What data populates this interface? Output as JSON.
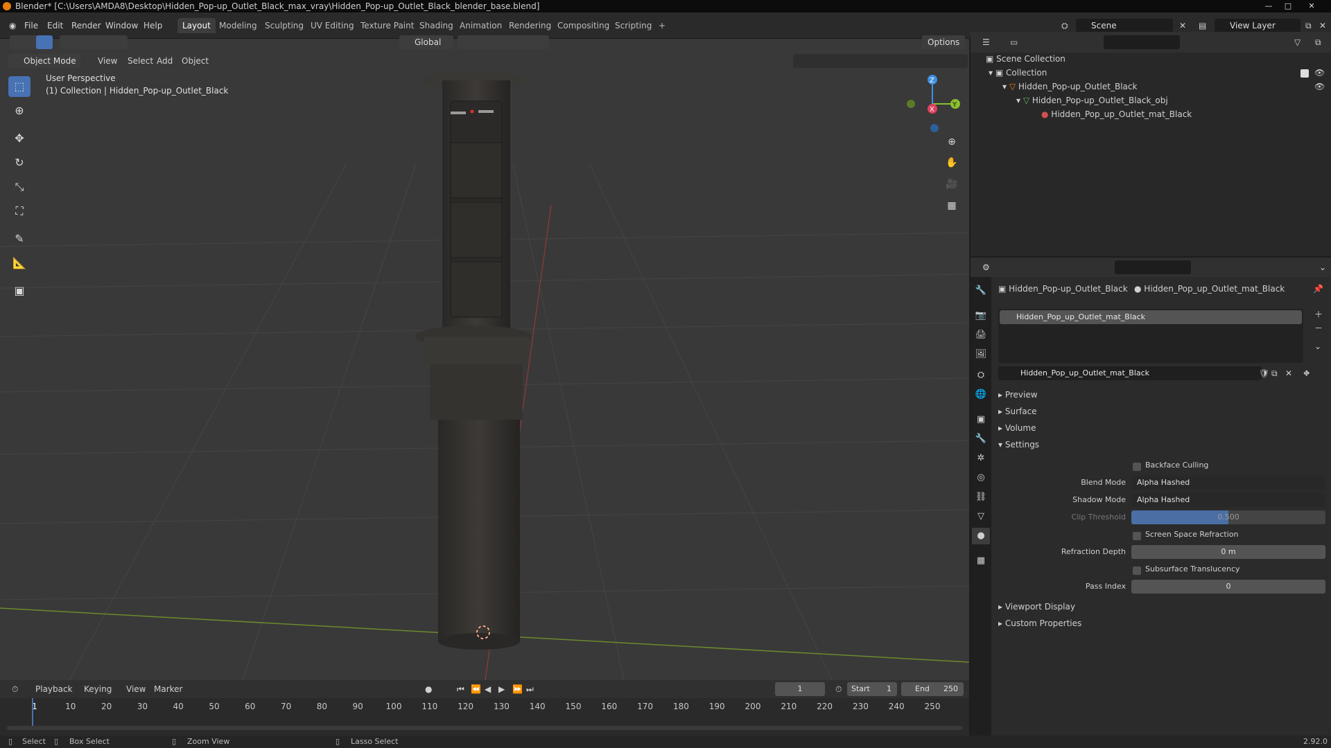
{
  "window": {
    "title": "Blender* [C:\\Users\\AMDA8\\Desktop\\Hidden_Pop-up_Outlet_Black_max_vray\\Hidden_Pop-up_Outlet_Black_blender_base.blend]",
    "minimize": "—",
    "maximize": "□",
    "close": "✕"
  },
  "menu": {
    "file": "File",
    "edit": "Edit",
    "render": "Render",
    "window": "Window",
    "help": "Help"
  },
  "workspaces": [
    "Layout",
    "Modeling",
    "Sculpting",
    "UV Editing",
    "Texture Paint",
    "Shading",
    "Animation",
    "Rendering",
    "Compositing",
    "Scripting"
  ],
  "add_workspace": "+",
  "scene": {
    "label": "Scene",
    "view_layer": "View Layer"
  },
  "toolbar_top": {
    "orientation": "Global",
    "options": "Options"
  },
  "viewport": {
    "mode": "Object Mode",
    "menus": {
      "view": "View",
      "select": "Select",
      "add": "Add",
      "object": "Object"
    },
    "overlay_line1": "User Perspective",
    "overlay_line2": "(1) Collection | Hidden_Pop-up_Outlet_Black",
    "gizmo": {
      "x": "X",
      "y": "Y",
      "z": "Z"
    }
  },
  "outliner": {
    "scene_collection": "Scene Collection",
    "collection": "Collection",
    "object": "Hidden_Pop-up_Outlet_Black",
    "mesh": "Hidden_Pop-up_Outlet_Black_obj",
    "material": "Hidden_Pop_up_Outlet_mat_Black"
  },
  "properties": {
    "breadcrumb_object": "Hidden_Pop-up_Outlet_Black",
    "breadcrumb_material": "Hidden_Pop_up_Outlet_mat_Black",
    "slot": "Hidden_Pop_up_Outlet_mat_Black",
    "material_name": "Hidden_Pop_up_Outlet_mat_Black",
    "panels": {
      "preview": "Preview",
      "surface": "Surface",
      "volume": "Volume",
      "settings": "Settings",
      "viewport_display": "Viewport Display",
      "custom_properties": "Custom Properties"
    },
    "settings": {
      "backface_culling": "Backface Culling",
      "blend_mode_label": "Blend Mode",
      "blend_mode": "Alpha Hashed",
      "shadow_mode_label": "Shadow Mode",
      "shadow_mode": "Alpha Hashed",
      "clip_threshold_label": "Clip Threshold",
      "clip_threshold": "0.500",
      "ssr": "Screen Space Refraction",
      "refraction_depth_label": "Refraction Depth",
      "refraction_depth": "0 m",
      "subsurface": "Subsurface Translucency",
      "pass_index_label": "Pass Index",
      "pass_index": "0"
    }
  },
  "timeline": {
    "playback": "Playback",
    "keying": "Keying",
    "view": "View",
    "marker": "Marker",
    "current_frame": "1",
    "start_label": "Start",
    "start": "1",
    "end_label": "End",
    "end": "250",
    "ticks": [
      "1",
      "10",
      "20",
      "30",
      "40",
      "50",
      "60",
      "70",
      "80",
      "90",
      "100",
      "110",
      "120",
      "130",
      "140",
      "150",
      "160",
      "170",
      "180",
      "190",
      "200",
      "210",
      "220",
      "230",
      "240",
      "250"
    ]
  },
  "statusbar": {
    "select": "Select",
    "box_select": "Box Select",
    "zoom_view": "Zoom View",
    "lasso_select": "Lasso Select",
    "version": "2.92.0"
  },
  "colors": {
    "accent": "#4772b3",
    "x_axis": "#e04060",
    "y_axis": "#8ac02d",
    "z_axis": "#3f8fe0",
    "object_orange": "#e87d0d"
  }
}
